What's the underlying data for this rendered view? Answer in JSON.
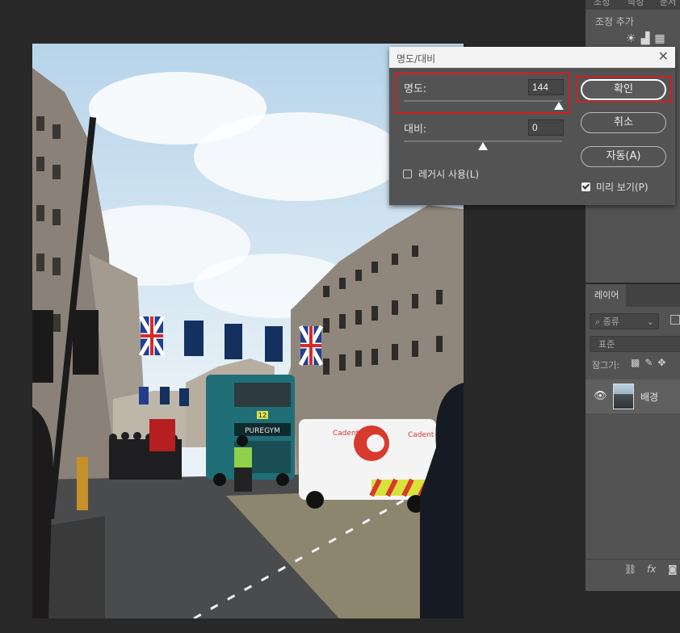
{
  "adjustments_panel": {
    "title": "조정 추가",
    "tab_partials": [
      "조정",
      "속성",
      "문서"
    ]
  },
  "layers_panel": {
    "tab_label": "레이어",
    "filter_kind": "종류",
    "blend_mode": "표준",
    "lock_label": "잠그기:",
    "layer": {
      "name": "배경",
      "visible": true
    },
    "footer_icons": [
      "link-icon",
      "fx-icon",
      "mask-icon"
    ]
  },
  "dialog": {
    "title": "명도/대비",
    "brightness": {
      "label": "명도:",
      "value": "144",
      "slider_fraction": 1.0
    },
    "contrast": {
      "label": "대비:",
      "value": "0",
      "slider_fraction": 0.5
    },
    "legacy": {
      "label": "레거시 사용(L)",
      "checked": false
    },
    "buttons": {
      "ok": "확인",
      "cancel": "취소",
      "auto": "자동(A)"
    },
    "preview": {
      "label": "미리 보기(P)",
      "checked": true
    },
    "highlight_color": "#d11f1f"
  },
  "photo": {
    "bus_route_sign": "12",
    "bus_ad": "PUREGYM",
    "van_brand": "Cadent"
  }
}
